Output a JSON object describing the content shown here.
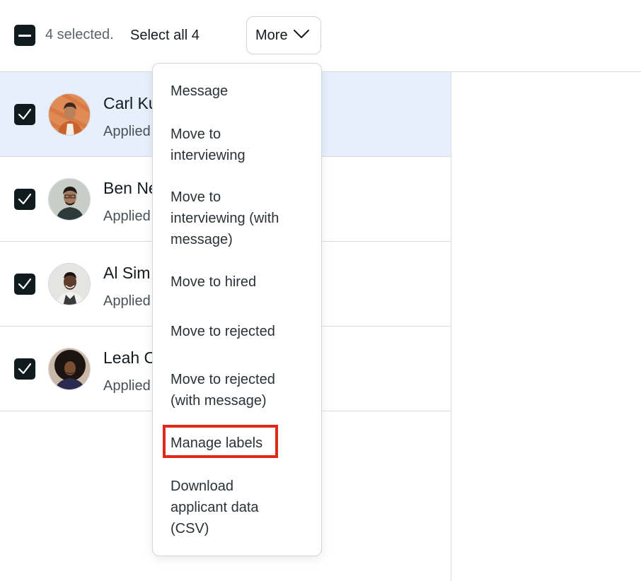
{
  "toolbar": {
    "selected_text": "4 selected.",
    "select_all_label": "Select all 4",
    "more_label": "More"
  },
  "rows": [
    {
      "name": "Carl Ku",
      "sub": "Applied",
      "checked": true,
      "selected": true
    },
    {
      "name": "Ben Ne",
      "sub": "Applied",
      "checked": true,
      "selected": false
    },
    {
      "name": "Al Sim",
      "sub": "Applied",
      "checked": true,
      "selected": false
    },
    {
      "name": "Leah C",
      "sub": "Applied",
      "checked": true,
      "selected": false
    }
  ],
  "menu": {
    "items": [
      "Message",
      "Move to interviewing",
      "Move to interviewing (with message)",
      "Move to hired",
      "Move to rejected",
      "Move to rejected (with message)",
      "Manage labels",
      "Download applicant data (CSV)"
    ],
    "highlighted_item": "Manage labels",
    "highlight_color": "#e0291b"
  },
  "colors": {
    "selected_row_bg": "#e7eefc",
    "checkbox_bg": "#0f1b1f",
    "divider": "#d9dcdf"
  }
}
